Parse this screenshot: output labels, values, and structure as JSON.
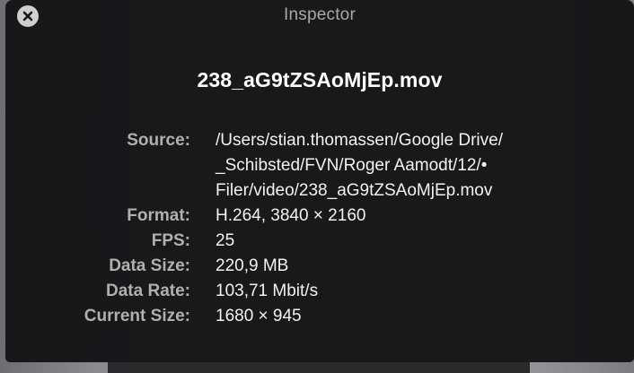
{
  "window": {
    "title": "Inspector"
  },
  "file": {
    "name": "238_aG9tZSAoMjEp.mov"
  },
  "info": {
    "source_label": "Source:",
    "source_lines": [
      "/Users/stian.thomassen/Google Drive/",
      "_Schibsted/FVN/Roger Aamodt/12/•",
      "Filer/video/238_aG9tZSAoMjEp.mov"
    ],
    "format_label": "Format:",
    "format_value": "H.264, 3840 × 2160",
    "fps_label": "FPS:",
    "fps_value": "25",
    "data_size_label": "Data Size:",
    "data_size_value": "220,9 MB",
    "data_rate_label": "Data Rate:",
    "data_rate_value": "103,71 Mbit/s",
    "current_size_label": "Current Size:",
    "current_size_value": "1680 × 945"
  },
  "icons": {
    "close": "close-icon"
  }
}
